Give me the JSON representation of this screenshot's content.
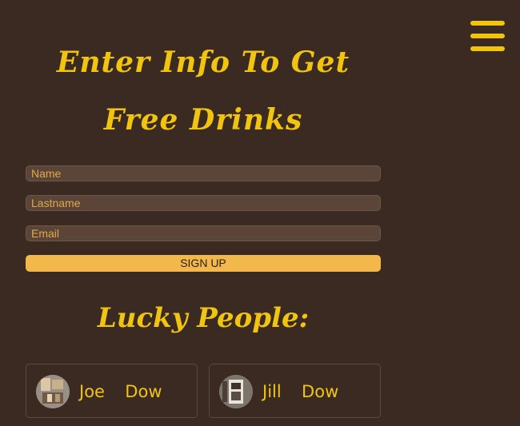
{
  "header": {
    "menu_icon": "hamburger-menu-icon",
    "title": "Enter Info To Get Free Drinks"
  },
  "form": {
    "name_placeholder": "Name",
    "lastname_placeholder": "Lastname",
    "email_placeholder": "Email",
    "signup_label": "SIGN UP"
  },
  "lucky": {
    "title": "Lucky People:",
    "people": [
      {
        "name": "Joe  Dow",
        "avatar": "avatar-photo"
      },
      {
        "name": "Jill  Dow",
        "avatar": "avatar-photo"
      }
    ]
  },
  "colors": {
    "background": "#3a2a22",
    "accent": "#f1c40f",
    "button": "#f2b84b",
    "input_bg": "#5a4538"
  }
}
